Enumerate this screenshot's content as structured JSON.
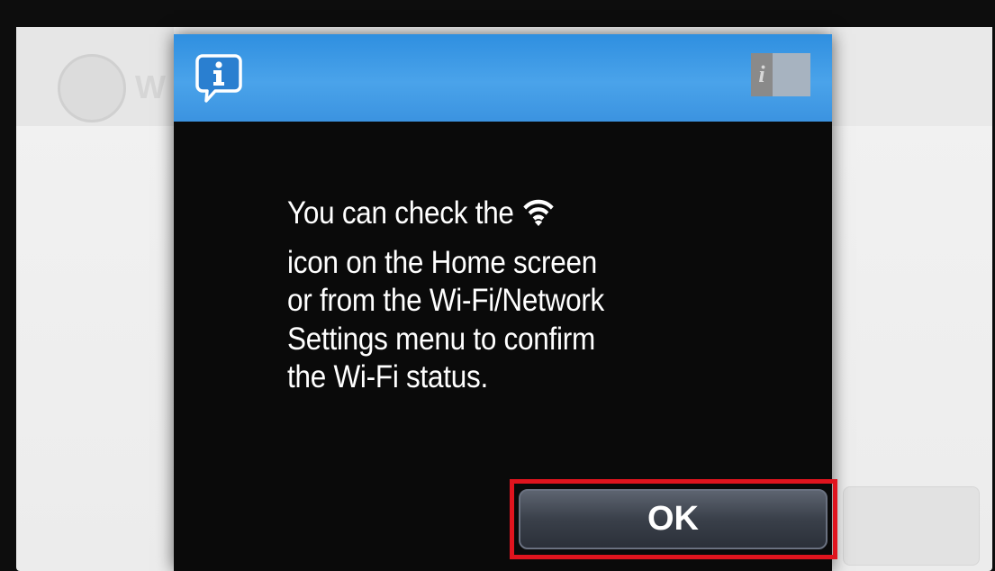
{
  "dialog": {
    "message_lines": [
      "You can check the",
      "icon on the Home screen",
      "or from the Wi-Fi/Network",
      "Settings menu to confirm",
      "the Wi-Fi status."
    ],
    "ok_label": "OK",
    "toggle_label": "i"
  },
  "background": {
    "ghost_text": "W"
  },
  "colors": {
    "header_blue": "#3b93e0",
    "dialog_bg": "#0a0a0a",
    "highlight_red": "#e0141e"
  },
  "icons": {
    "header_left": "info-speech-bubble-icon",
    "header_right": "info-toggle-icon",
    "inline": "wifi-icon"
  }
}
